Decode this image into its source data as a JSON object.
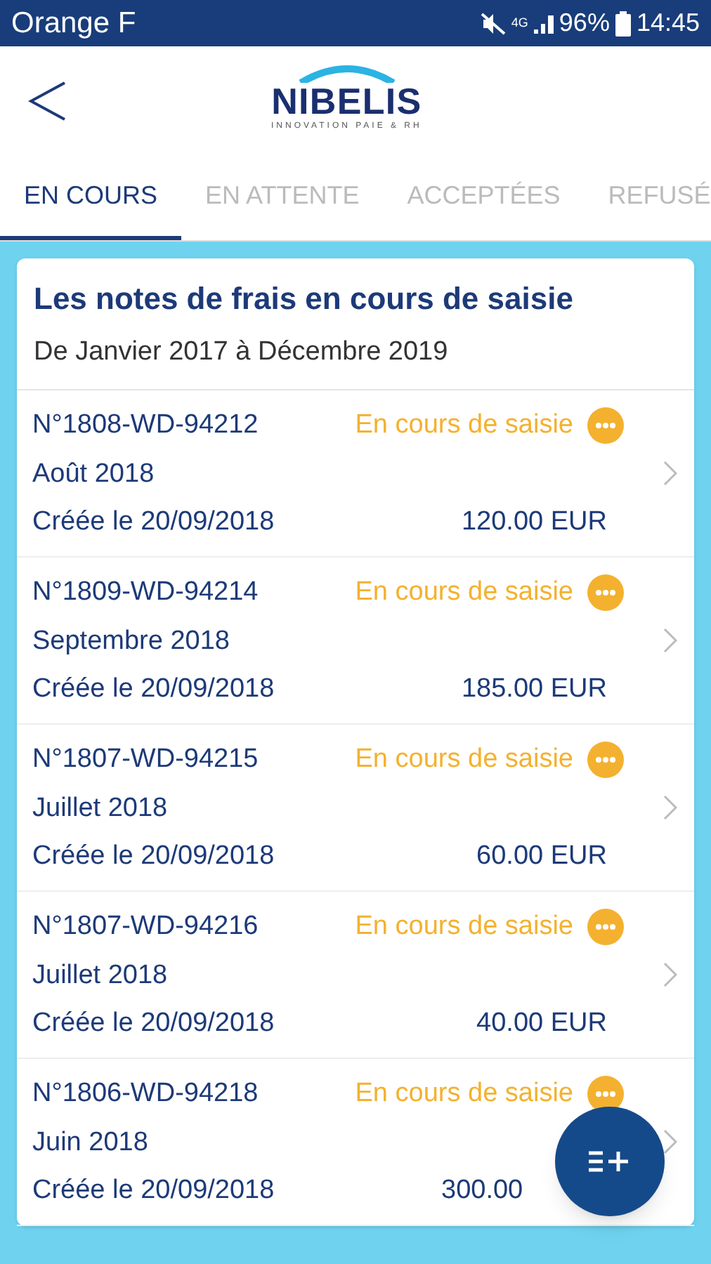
{
  "status_bar": {
    "carrier": "Orange F",
    "network": "4G",
    "battery": "96%",
    "time": "14:45"
  },
  "header": {
    "logo_name": "NIBELIS",
    "logo_tagline": "INNOVATION PAIE & RH"
  },
  "tabs": [
    {
      "label": "EN COURS",
      "selected": true
    },
    {
      "label": "EN ATTENTE",
      "selected": false
    },
    {
      "label": "ACCEPTÉES",
      "selected": false
    },
    {
      "label": "REFUSÉ",
      "selected": false
    }
  ],
  "card": {
    "title": "Les notes de frais en cours de saisie",
    "period": "De Janvier 2017 à Décembre 2019",
    "rows": [
      {
        "number": "N°1808-WD-94212",
        "status": "En cours de saisie",
        "month": "Août 2018",
        "created": "Créée le 20/09/2018",
        "amount": "120.00 EUR"
      },
      {
        "number": "N°1809-WD-94214",
        "status": "En cours de saisie",
        "month": "Septembre 2018",
        "created": "Créée le 20/09/2018",
        "amount": "185.00 EUR"
      },
      {
        "number": "N°1807-WD-94215",
        "status": "En cours de saisie",
        "month": "Juillet 2018",
        "created": "Créée le 20/09/2018",
        "amount": "60.00 EUR"
      },
      {
        "number": "N°1807-WD-94216",
        "status": "En cours de saisie",
        "month": "Juillet 2018",
        "created": "Créée le 20/09/2018",
        "amount": "40.00 EUR"
      },
      {
        "number": "N°1806-WD-94218",
        "status": "En cours de saisie",
        "month": "Juin 2018",
        "created": "Créée le 20/09/2018",
        "amount": "300.00"
      }
    ]
  }
}
